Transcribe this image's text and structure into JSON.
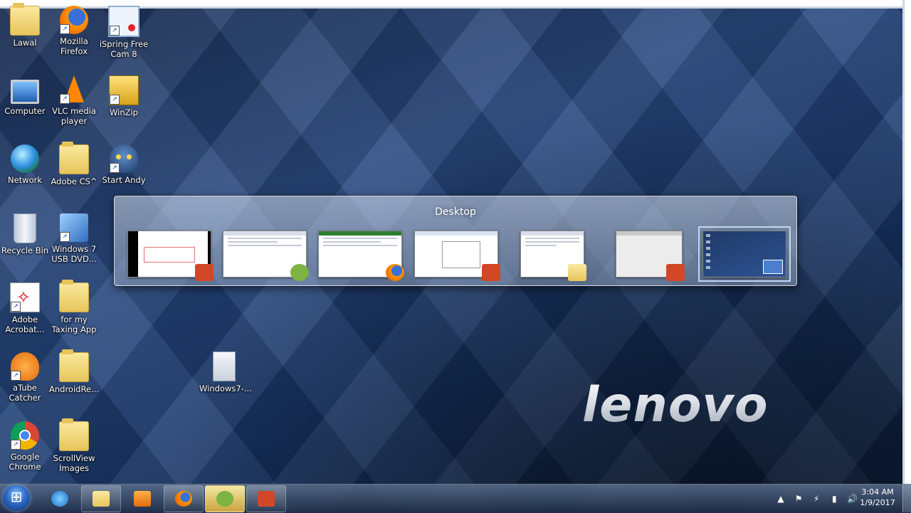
{
  "desktop": {
    "icons": [
      {
        "label": "Lawal"
      },
      {
        "label": "Mozilla Firefox"
      },
      {
        "label": "iSpring Free Cam 8"
      },
      {
        "label": "Computer"
      },
      {
        "label": "VLC media player"
      },
      {
        "label": "WinZip"
      },
      {
        "label": "Network"
      },
      {
        "label": "Adobe CS^"
      },
      {
        "label": "Start Andy"
      },
      {
        "label": "Recycle Bin"
      },
      {
        "label": "Windows 7 USB DVD..."
      },
      {
        "label": "Adobe Acrobat..."
      },
      {
        "label": "for my Taxing App"
      },
      {
        "label": "aTube Catcher"
      },
      {
        "label": "AndroidRe..."
      },
      {
        "label": "Google Chrome"
      },
      {
        "label": "ScrollView Images"
      },
      {
        "label": "Windows7-..."
      }
    ]
  },
  "switcher": {
    "title": "Desktop",
    "windows": [
      "powerpoint-window",
      "android-studio-window",
      "firefox-window",
      "powerpoint-window",
      "explorer-window",
      "powerpoint-window",
      "desktop"
    ]
  },
  "logo": {
    "text": "lenovo"
  },
  "taskbar": {
    "clock": {
      "time": "3:04 AM",
      "date": "1/9/2017"
    }
  },
  "colors": {
    "accent": "#2c6ac9",
    "powerpoint": "#d24726",
    "firefox": "#e66000",
    "android": "#7cb342",
    "folder": "#e7c55a"
  }
}
